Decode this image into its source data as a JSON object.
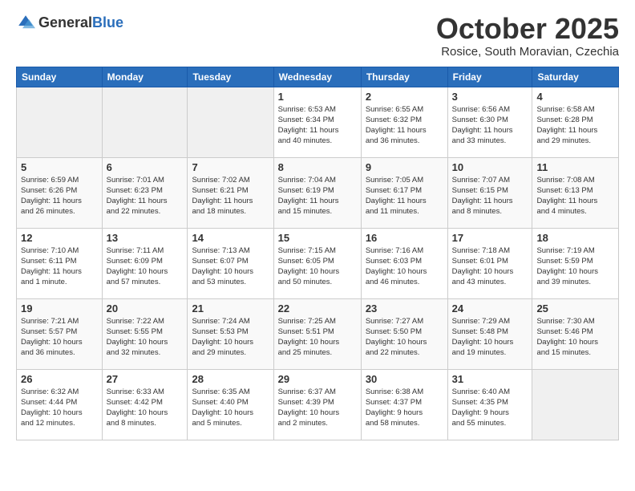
{
  "logo": {
    "general": "General",
    "blue": "Blue"
  },
  "title": "October 2025",
  "location": "Rosice, South Moravian, Czechia",
  "days_header": [
    "Sunday",
    "Monday",
    "Tuesday",
    "Wednesday",
    "Thursday",
    "Friday",
    "Saturday"
  ],
  "weeks": [
    [
      {
        "day": "",
        "info": ""
      },
      {
        "day": "",
        "info": ""
      },
      {
        "day": "",
        "info": ""
      },
      {
        "day": "1",
        "info": "Sunrise: 6:53 AM\nSunset: 6:34 PM\nDaylight: 11 hours\nand 40 minutes."
      },
      {
        "day": "2",
        "info": "Sunrise: 6:55 AM\nSunset: 6:32 PM\nDaylight: 11 hours\nand 36 minutes."
      },
      {
        "day": "3",
        "info": "Sunrise: 6:56 AM\nSunset: 6:30 PM\nDaylight: 11 hours\nand 33 minutes."
      },
      {
        "day": "4",
        "info": "Sunrise: 6:58 AM\nSunset: 6:28 PM\nDaylight: 11 hours\nand 29 minutes."
      }
    ],
    [
      {
        "day": "5",
        "info": "Sunrise: 6:59 AM\nSunset: 6:26 PM\nDaylight: 11 hours\nand 26 minutes."
      },
      {
        "day": "6",
        "info": "Sunrise: 7:01 AM\nSunset: 6:23 PM\nDaylight: 11 hours\nand 22 minutes."
      },
      {
        "day": "7",
        "info": "Sunrise: 7:02 AM\nSunset: 6:21 PM\nDaylight: 11 hours\nand 18 minutes."
      },
      {
        "day": "8",
        "info": "Sunrise: 7:04 AM\nSunset: 6:19 PM\nDaylight: 11 hours\nand 15 minutes."
      },
      {
        "day": "9",
        "info": "Sunrise: 7:05 AM\nSunset: 6:17 PM\nDaylight: 11 hours\nand 11 minutes."
      },
      {
        "day": "10",
        "info": "Sunrise: 7:07 AM\nSunset: 6:15 PM\nDaylight: 11 hours\nand 8 minutes."
      },
      {
        "day": "11",
        "info": "Sunrise: 7:08 AM\nSunset: 6:13 PM\nDaylight: 11 hours\nand 4 minutes."
      }
    ],
    [
      {
        "day": "12",
        "info": "Sunrise: 7:10 AM\nSunset: 6:11 PM\nDaylight: 11 hours\nand 1 minute."
      },
      {
        "day": "13",
        "info": "Sunrise: 7:11 AM\nSunset: 6:09 PM\nDaylight: 10 hours\nand 57 minutes."
      },
      {
        "day": "14",
        "info": "Sunrise: 7:13 AM\nSunset: 6:07 PM\nDaylight: 10 hours\nand 53 minutes."
      },
      {
        "day": "15",
        "info": "Sunrise: 7:15 AM\nSunset: 6:05 PM\nDaylight: 10 hours\nand 50 minutes."
      },
      {
        "day": "16",
        "info": "Sunrise: 7:16 AM\nSunset: 6:03 PM\nDaylight: 10 hours\nand 46 minutes."
      },
      {
        "day": "17",
        "info": "Sunrise: 7:18 AM\nSunset: 6:01 PM\nDaylight: 10 hours\nand 43 minutes."
      },
      {
        "day": "18",
        "info": "Sunrise: 7:19 AM\nSunset: 5:59 PM\nDaylight: 10 hours\nand 39 minutes."
      }
    ],
    [
      {
        "day": "19",
        "info": "Sunrise: 7:21 AM\nSunset: 5:57 PM\nDaylight: 10 hours\nand 36 minutes."
      },
      {
        "day": "20",
        "info": "Sunrise: 7:22 AM\nSunset: 5:55 PM\nDaylight: 10 hours\nand 32 minutes."
      },
      {
        "day": "21",
        "info": "Sunrise: 7:24 AM\nSunset: 5:53 PM\nDaylight: 10 hours\nand 29 minutes."
      },
      {
        "day": "22",
        "info": "Sunrise: 7:25 AM\nSunset: 5:51 PM\nDaylight: 10 hours\nand 25 minutes."
      },
      {
        "day": "23",
        "info": "Sunrise: 7:27 AM\nSunset: 5:50 PM\nDaylight: 10 hours\nand 22 minutes."
      },
      {
        "day": "24",
        "info": "Sunrise: 7:29 AM\nSunset: 5:48 PM\nDaylight: 10 hours\nand 19 minutes."
      },
      {
        "day": "25",
        "info": "Sunrise: 7:30 AM\nSunset: 5:46 PM\nDaylight: 10 hours\nand 15 minutes."
      }
    ],
    [
      {
        "day": "26",
        "info": "Sunrise: 6:32 AM\nSunset: 4:44 PM\nDaylight: 10 hours\nand 12 minutes."
      },
      {
        "day": "27",
        "info": "Sunrise: 6:33 AM\nSunset: 4:42 PM\nDaylight: 10 hours\nand 8 minutes."
      },
      {
        "day": "28",
        "info": "Sunrise: 6:35 AM\nSunset: 4:40 PM\nDaylight: 10 hours\nand 5 minutes."
      },
      {
        "day": "29",
        "info": "Sunrise: 6:37 AM\nSunset: 4:39 PM\nDaylight: 10 hours\nand 2 minutes."
      },
      {
        "day": "30",
        "info": "Sunrise: 6:38 AM\nSunset: 4:37 PM\nDaylight: 9 hours\nand 58 minutes."
      },
      {
        "day": "31",
        "info": "Sunrise: 6:40 AM\nSunset: 4:35 PM\nDaylight: 9 hours\nand 55 minutes."
      },
      {
        "day": "",
        "info": ""
      }
    ]
  ]
}
